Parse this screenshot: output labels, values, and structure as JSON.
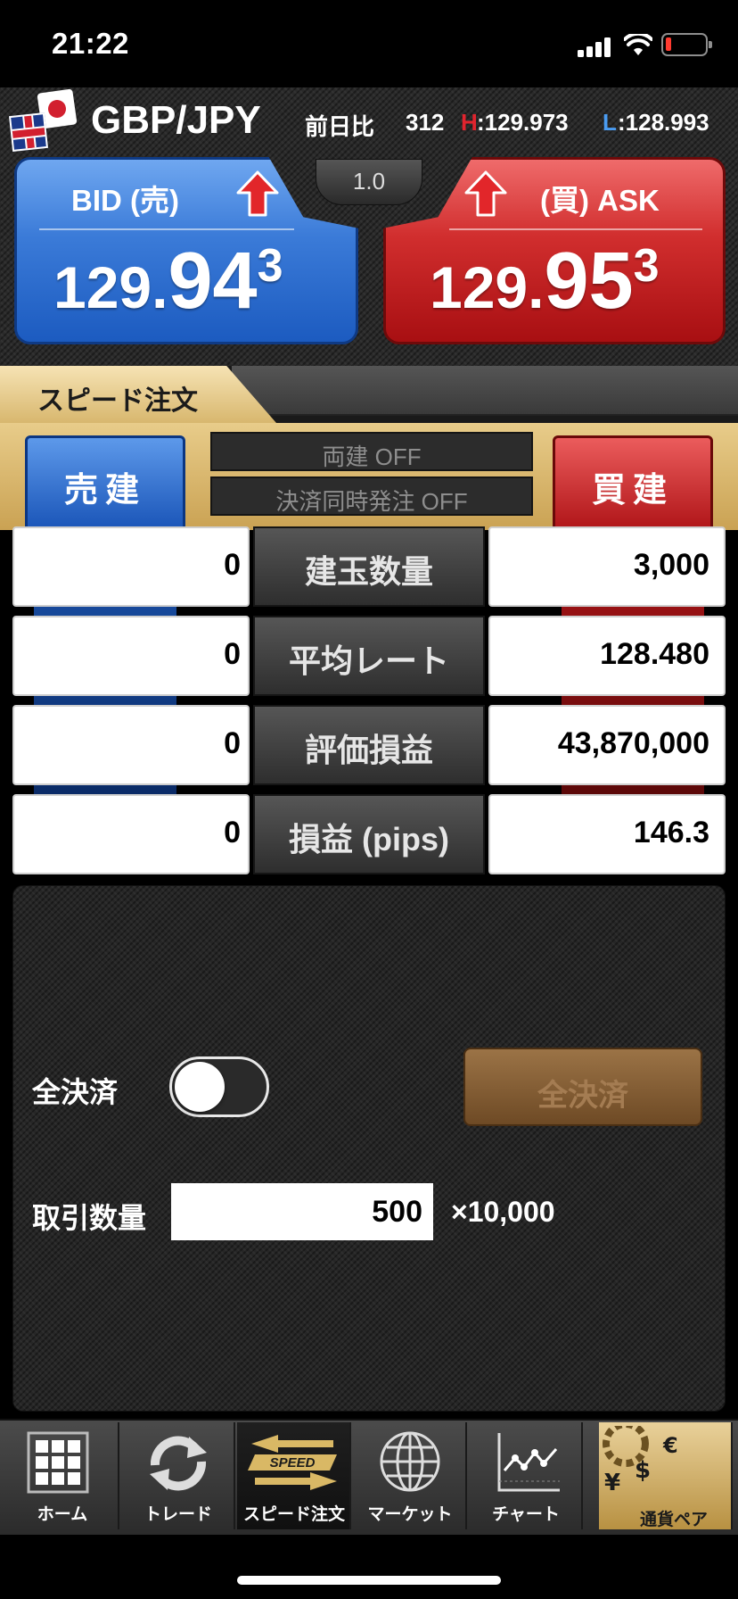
{
  "status_bar": {
    "time": "21:22"
  },
  "header": {
    "pair": "GBP/JPY",
    "prev_label": "前日比",
    "prev_value": "312",
    "high_letter": "H",
    "high_value": ":129.973",
    "low_letter": "L",
    "low_value": ":128.993",
    "spread": "1.0"
  },
  "bid": {
    "label": "BID (売)",
    "price_main": "129.",
    "price_big": "94",
    "price_small": "3"
  },
  "ask": {
    "label": "(買) ASK",
    "price_main": "129.",
    "price_big": "95",
    "price_small": "3"
  },
  "speed_tab": {
    "label": "スピード注文"
  },
  "order": {
    "sell_label": "売建",
    "buy_label": "買建",
    "option_hedge": "両建 OFF",
    "option_settle": "決済同時発注 OFF"
  },
  "positions": [
    {
      "label": "建玉数量",
      "sell": "0",
      "buy": "3,000"
    },
    {
      "label": "平均レート",
      "sell": "0",
      "buy": "128.480"
    },
    {
      "label": "評価損益",
      "sell": "0",
      "buy": "43,870,000"
    },
    {
      "label": "損益 (pips)",
      "sell": "0",
      "buy": "146.3"
    }
  ],
  "controls": {
    "close_all_label": "全決済",
    "close_all_button": "全決済",
    "qty_label": "取引数量",
    "qty_value": "500",
    "qty_unit": "×10,000"
  },
  "tabs": [
    {
      "label": "ホーム"
    },
    {
      "label": "トレード"
    },
    {
      "label": "スピード注文"
    },
    {
      "label": "マーケット"
    },
    {
      "label": "チャート"
    },
    {
      "label": "通貨ペア"
    }
  ],
  "icons": {
    "speed_logo": "SPEED",
    "currency_symbols": [
      "€",
      "¥",
      "$"
    ]
  },
  "colors": {
    "bid": "#2a6bd0",
    "ask": "#c81f22",
    "high": "#e0242e",
    "low": "#4a9cf2",
    "gold": "#d8b76e"
  }
}
